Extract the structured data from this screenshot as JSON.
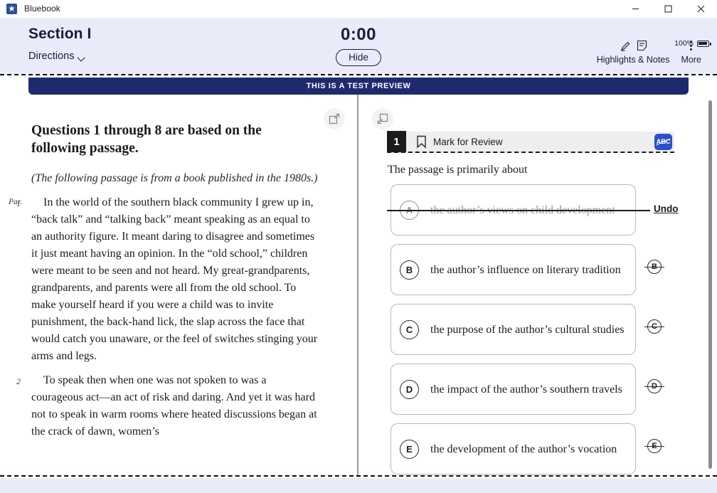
{
  "window": {
    "title": "Bluebook",
    "app_icon": "bluebook-star-icon",
    "controls": {
      "minimize": "minimize-icon",
      "maximize": "maximize-icon",
      "close": "close-icon"
    }
  },
  "header": {
    "section_title": "Section I",
    "directions_label": "Directions",
    "timer": "0:00",
    "hide_label": "Hide",
    "highlights_notes_label": "Highlights & Notes",
    "more_label": "More",
    "battery_percent": "100%",
    "accent_color": "#1f2a6e",
    "header_bg": "#e9ecf8"
  },
  "banner": {
    "text": "THIS IS A TEST PREVIEW",
    "bg_color": "#1f2a6e"
  },
  "panel_toggles": {
    "expand_label": "expand-passage-panel",
    "collapse_label": "collapse-question-panel"
  },
  "passage": {
    "heading": "Questions 1 through 8 are based on the following passage.",
    "intro": "(The following passage is from a book published in the 1980s.)",
    "par_label": "Par.",
    "paragraphs": [
      {
        "number": "1",
        "text": "In the world of the southern black community I grew up in, “back talk” and “talking back” meant speaking as an equal to an authority figure. It meant daring to disagree and sometimes it just meant having an opinion. In the “old school,” children were meant to be seen and not heard. My great-grandparents, grandparents, and parents were all from the old school. To make yourself heard if you were a child was to invite punishment, the back-hand lick, the slap across the face that would catch you unaware, or the feel of switches stinging your arms and legs."
      },
      {
        "number": "2",
        "text": "To speak then when one was not spoken to was a courageous act—an act of risk and daring. And yet it was hard not to speak in warm rooms where heated discussions began at the crack of dawn, women’s"
      }
    ]
  },
  "question": {
    "number": "1",
    "mark_for_review_label": "Mark for Review",
    "abc_button_label": "ABC",
    "stem": "The passage is primarily about",
    "undo_label": "Undo",
    "choices": [
      {
        "letter": "A",
        "text": "the author’s views on child development",
        "eliminated": true
      },
      {
        "letter": "B",
        "text": "the author’s influence on literary tradition",
        "eliminated": false
      },
      {
        "letter": "C",
        "text": "the purpose of the author’s cultural studies",
        "eliminated": false
      },
      {
        "letter": "D",
        "text": "the impact of the author’s southern travels",
        "eliminated": false
      },
      {
        "letter": "E",
        "text": "the development of the author’s vocation",
        "eliminated": false
      }
    ]
  }
}
